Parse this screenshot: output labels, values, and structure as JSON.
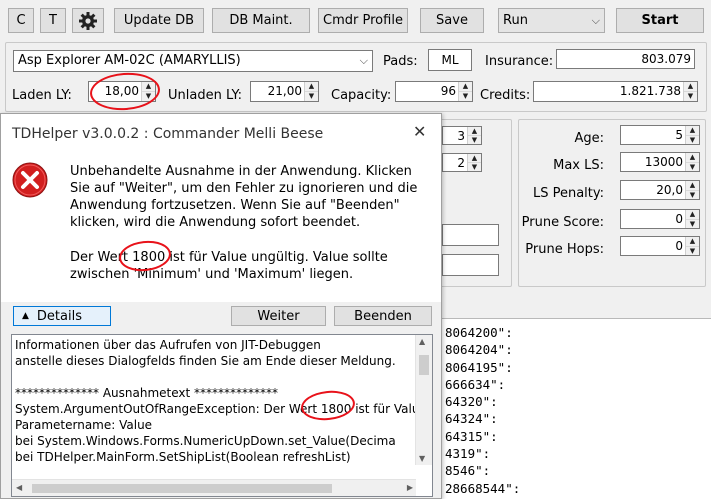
{
  "toolbar": {
    "c_label": "C",
    "t_label": "T",
    "update_db": "Update DB",
    "db_maint": "DB Maint.",
    "cmdr_profile": "Cmdr Profile",
    "save": "Save",
    "mode_selected": "Run",
    "start": "Start"
  },
  "ship": {
    "selected": "Asp Explorer AM-02C (AMARYLLIS)",
    "pads_label": "Pads:",
    "pads_value": "ML",
    "insurance_label": "Insurance:",
    "insurance_value": "803.079",
    "laden_label": "Laden LY:",
    "laden_value": "18,00",
    "unladen_label": "Unladen LY:",
    "unladen_value": "21,00",
    "capacity_label": "Capacity:",
    "capacity_value": "96",
    "credits_label": "Credits:",
    "credits_value": "1.821.738"
  },
  "middle": {
    "spin1": "3",
    "spin2": "2"
  },
  "right_panel": {
    "age_label": "Age:",
    "age_value": "5",
    "maxls_label": "Max LS:",
    "maxls_value": "13000",
    "lspenalty_label": "LS Penalty:",
    "lspenalty_value": "20,0",
    "prunescore_label": "Prune Score:",
    "prunescore_value": "0",
    "prunehops_label": "Prune Hops:",
    "prunehops_value": "0"
  },
  "output_lines": [
    "8064200\":",
    "8064204\":",
    "8064195\":",
    "666634\":",
    "64320\":",
    "64324\":",
    "64315\":",
    "4319\":",
    "8546\":",
    "28668544\":"
  ],
  "dialog": {
    "title": "TDHelper v3.0.0.2 : Commander Melli Beese",
    "message1": [
      "Unbehandelte Ausnahme in der Anwendung. Klicken",
      "Sie auf \"Weiter\", um den Fehler zu ignorieren und die",
      "Anwendung fortzusetzen. Wenn Sie auf \"Beenden\"",
      "klicken, wird die Anwendung sofort beendet."
    ],
    "message2": [
      "Der Wert 1800 ist für Value ungültig. Value sollte",
      "zwischen 'Minimum' und 'Maximum' liegen."
    ],
    "details_label": "Details",
    "weiter": "Weiter",
    "beenden": "Beenden",
    "details_lines": [
      "Informationen über das Aufrufen von JIT-Debuggen",
      "anstelle dieses Dialogfelds finden Sie am Ende dieser Meldung.",
      "",
      "************** Ausnahmetext **************",
      "System.ArgumentOutOfRangeException: Der Wert 1800 ist für Value",
      "Parametername: Value",
      "   bei System.Windows.Forms.NumericUpDown.set_Value(Decima",
      "   bei TDHelper.MainForm.SetShipList(Boolean refreshList)"
    ]
  }
}
